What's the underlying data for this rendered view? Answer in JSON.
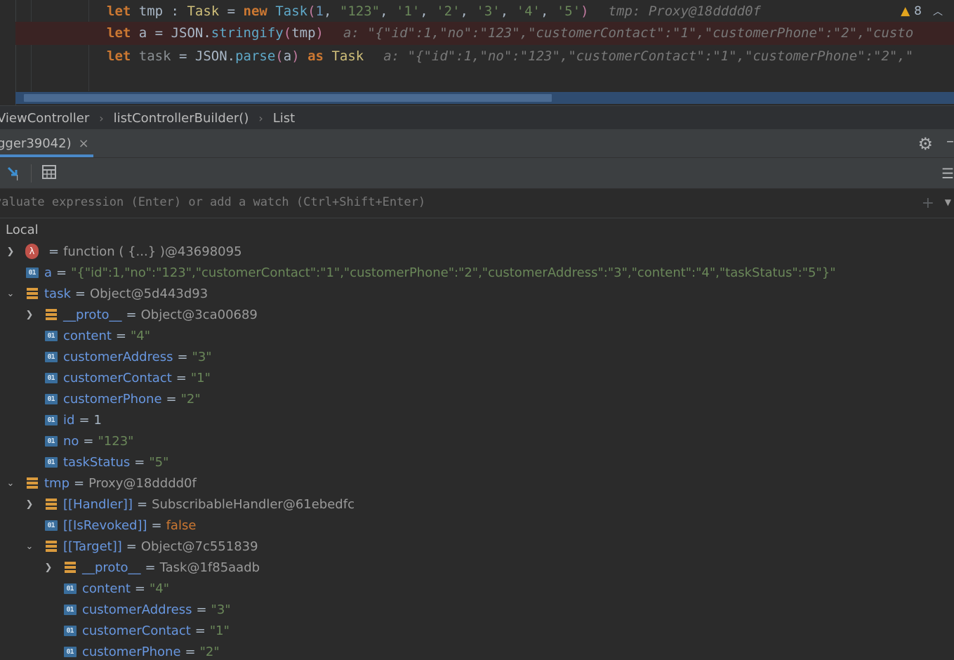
{
  "editor": {
    "line1": {
      "kw": "let",
      "name": "tmp",
      "colon": " : ",
      "type": "Task",
      "eq": " = ",
      "new": "new",
      "ctor": "Task",
      "args": [
        "1",
        "\"123\"",
        "'1'",
        "'2'",
        "'3'",
        "'4'",
        "'5'"
      ],
      "hint_label": "tmp:",
      "hint_value": "Proxy@18dddd0f"
    },
    "line2": {
      "kw": "let",
      "name": "a",
      "eq": " = ",
      "obj": "JSON",
      "method": "stringify",
      "arg": "tmp",
      "hint_label": "a:",
      "hint_value": "\"{\"id\":1,\"no\":\"123\",\"customerContact\":\"1\",\"customerPhone\":\"2\",\"custo"
    },
    "line3": {
      "kw": "let",
      "name": "task",
      "eq": " = ",
      "obj": "JSON",
      "method": "parse",
      "arg": "a",
      "as": "as",
      "type": "Task",
      "hint_label": "a:",
      "hint_value": "\"{\"id\":1,\"no\":\"123\",\"customerContact\":\"1\",\"customerPhone\":\"2\",\""
    },
    "warning_count": "8"
  },
  "breadcrumb": {
    "items": [
      "ViewController",
      "listControllerBuilder()",
      "List"
    ]
  },
  "debug_tab": {
    "label": "gger39042)",
    "close": "×"
  },
  "eval": {
    "placeholder": "valuate expression (Enter) or add a watch (Ctrl+Shift+Enter)"
  },
  "tree": {
    "section": "Local",
    "rows": [
      {
        "name": "",
        "value": "function ( {...} )@43698095"
      },
      {
        "name": "a",
        "value": "\"{\"id\":1,\"no\":\"123\",\"customerContact\":\"1\",\"customerPhone\":\"2\",\"customerAddress\":\"3\",\"content\":\"4\",\"taskStatus\":\"5\"}\""
      },
      {
        "name": "task",
        "value": "Object@5d443d93"
      },
      {
        "name": "__proto__",
        "value": "Object@3ca00689"
      },
      {
        "name": "content",
        "value": "\"4\""
      },
      {
        "name": "customerAddress",
        "value": "\"3\""
      },
      {
        "name": "customerContact",
        "value": "\"1\""
      },
      {
        "name": "customerPhone",
        "value": "\"2\""
      },
      {
        "name": "id",
        "value": "1"
      },
      {
        "name": "no",
        "value": "\"123\""
      },
      {
        "name": "taskStatus",
        "value": "\"5\""
      },
      {
        "name": "tmp",
        "value": "Proxy@18dddd0f"
      },
      {
        "name": "[[Handler]]",
        "value": "SubscribableHandler@61ebedfc"
      },
      {
        "name": "[[IsRevoked]]",
        "value": "false"
      },
      {
        "name": "[[Target]]",
        "value": "Object@7c551839"
      },
      {
        "name": "__proto__",
        "value": "Task@1f85aadb"
      },
      {
        "name": "content",
        "value": "\"4\""
      },
      {
        "name": "customerAddress",
        "value": "\"3\""
      },
      {
        "name": "customerContact",
        "value": "\"1\""
      },
      {
        "name": "customerPhone",
        "value": "\"2\""
      }
    ]
  }
}
